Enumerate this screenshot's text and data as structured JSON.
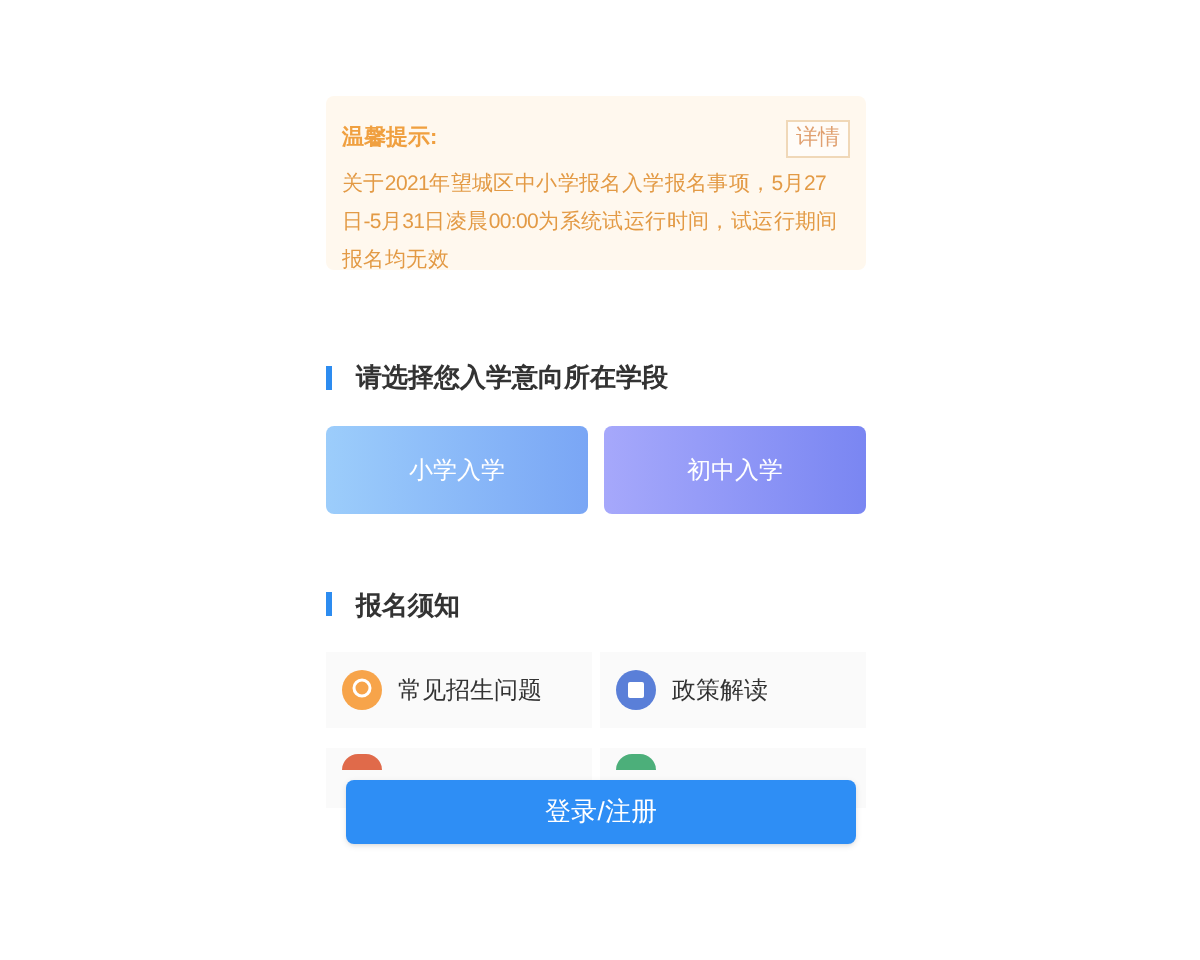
{
  "notice": {
    "title": "温馨提示:",
    "detail_button": "详情",
    "text": "关于2021年望城区中小学报名入学报名事项，5月27日-5月31日凌晨00:00为系统试运行时间，试运行期间报名均无效"
  },
  "stage_section": {
    "heading": "请选择您入学意向所在学段",
    "options": [
      {
        "label": "小学入学",
        "kind": "primary"
      },
      {
        "label": "初中入学",
        "kind": "middle"
      }
    ]
  },
  "notes_section": {
    "heading": "报名须知",
    "items": [
      {
        "label": "常见招生问题",
        "kind": "faq"
      },
      {
        "label": "政策解读",
        "kind": "policy"
      }
    ]
  },
  "login_button": "登录/注册"
}
